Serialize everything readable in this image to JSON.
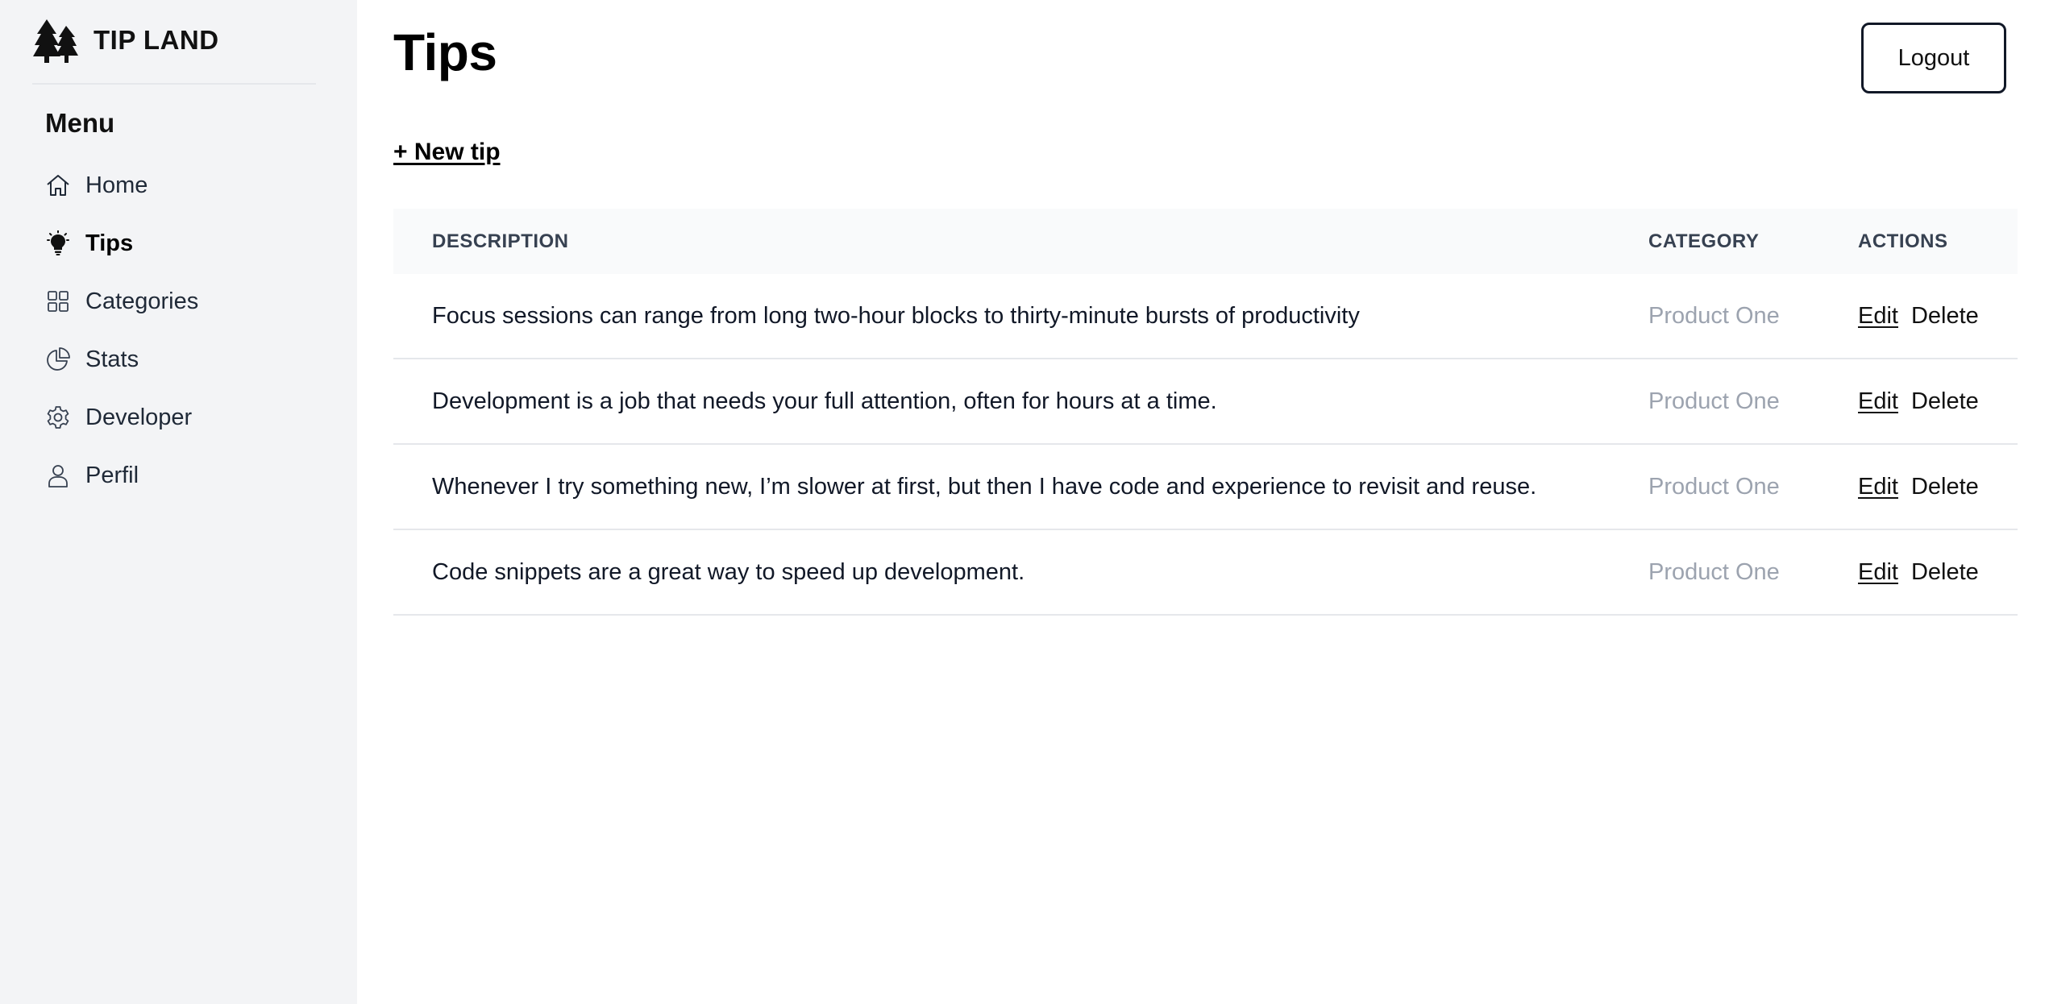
{
  "brand": {
    "name": "TIP LAND",
    "icon": "trees-icon"
  },
  "sidebar": {
    "menu_title": "Menu",
    "items": [
      {
        "label": "Home",
        "icon": "home-icon",
        "active": false
      },
      {
        "label": "Tips",
        "icon": "lightbulb-icon",
        "active": true
      },
      {
        "label": "Categories",
        "icon": "grid-icon",
        "active": false
      },
      {
        "label": "Stats",
        "icon": "pie-chart-icon",
        "active": false
      },
      {
        "label": "Developer",
        "icon": "gear-icon",
        "active": false
      },
      {
        "label": "Perfil",
        "icon": "user-icon",
        "active": false
      }
    ]
  },
  "header": {
    "title": "Tips",
    "logout_label": "Logout",
    "new_tip_label": "+ New tip"
  },
  "table": {
    "columns": [
      "DESCRIPTION",
      "CATEGORY",
      "ACTIONS"
    ],
    "edit_label": "Edit",
    "delete_label": "Delete",
    "rows": [
      {
        "description": "Focus sessions can range from long two-hour blocks to thirty-minute bursts of productivity",
        "category": "Product One"
      },
      {
        "description": "Development is a job that needs your full attention, often for hours at a time.",
        "category": "Product One"
      },
      {
        "description": "Whenever I try something new, I’m slower at first, but then I have code and experience to revisit and reuse.",
        "category": "Product One"
      },
      {
        "description": "Code snippets are a great way to speed up development.",
        "category": "Product One"
      }
    ]
  },
  "colors": {
    "sidebar_bg": "#f3f4f6",
    "table_header_bg": "#f9fafb",
    "category_text": "#9ca3af",
    "divider": "#e5e7eb"
  }
}
